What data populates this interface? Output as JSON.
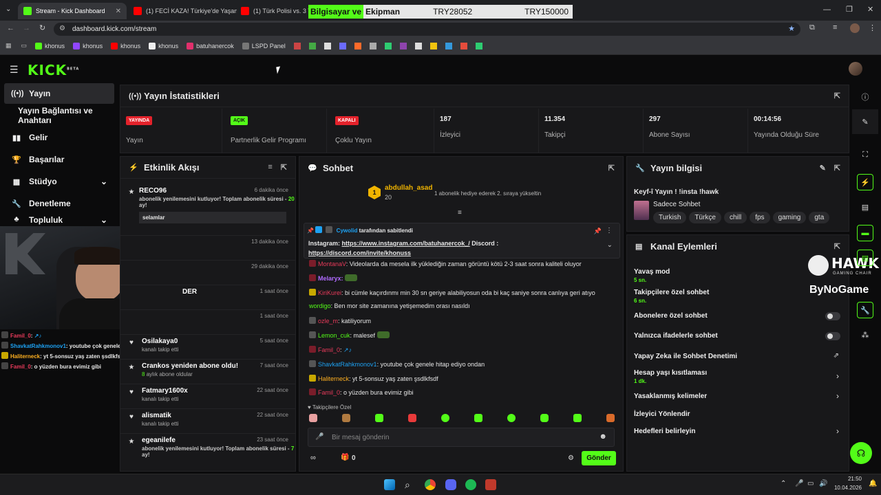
{
  "browser": {
    "tabs": [
      {
        "title": "Stream - Kick Dashboard",
        "active": true,
        "fav_color": "#53fc18"
      },
      {
        "title": "(1) FECİ KAZA! Türkiye'de Yaşan",
        "active": false,
        "fav_color": "#ff0000"
      },
      {
        "title": "(1) Türk Polisi vs. 3 Terö",
        "active": false,
        "fav_color": "#ff0000"
      }
    ],
    "overlay": {
      "text1": "Bilgisayar ve",
      "text2": "Ekipman",
      "price1": "TRY28052",
      "price2": "TRY150000"
    },
    "url": "dashboard.kick.com/stream",
    "bookmarks": [
      {
        "label": "khonus",
        "color": "#53fc18"
      },
      {
        "label": "khonus",
        "color": "#9146ff"
      },
      {
        "label": "khonus",
        "color": "#ff0000"
      },
      {
        "label": "khonus",
        "color": "#ffffff"
      },
      {
        "label": "batuhanercok",
        "color": "#e1306c"
      },
      {
        "label": "LSPD Panel",
        "color": "#777777"
      }
    ]
  },
  "sidebar": {
    "items": [
      {
        "label": "Yayın",
        "icon": "broadcast-icon",
        "active": true
      },
      {
        "label": "Yayın Bağlantısı ve Anahtarı",
        "icon": "",
        "active": false
      },
      {
        "label": "Gelir",
        "icon": "chart-icon",
        "active": false
      },
      {
        "label": "Başarılar",
        "icon": "trophy-icon",
        "active": false
      },
      {
        "label": "Stüdyo",
        "icon": "studio-icon",
        "active": false
      },
      {
        "label": "Denetleme",
        "icon": "wrench-icon",
        "active": false
      },
      {
        "label": "Topluluk",
        "icon": "community-icon",
        "active": false
      }
    ]
  },
  "stats": {
    "title": "Yayın İstatistikleri",
    "items": [
      {
        "pill": "YAYINDA",
        "pill_color": "#e4222b",
        "label": "Yayın"
      },
      {
        "pill": "AÇIK",
        "pill_color": "#53fc18",
        "label": "Partnerlik Gelir Programı"
      },
      {
        "pill": "KAPALI",
        "pill_color": "#e4222b",
        "label": "Çoklu Yayın"
      },
      {
        "value": "187",
        "label": "İzleyici"
      },
      {
        "value": "11.354",
        "label": "Takipçi"
      },
      {
        "value": "297",
        "label": "Abone Sayısı"
      },
      {
        "value": "00:14:56",
        "label": "Yayında Olduğu Süre"
      }
    ]
  },
  "activity": {
    "title": "Etkinlik Akışı",
    "events": [
      {
        "name": "RECO96",
        "time": "6 dakika önce",
        "desc": "abonelik yenilemesini kutluyor! Toplam abonelik süresi -",
        "months": "20",
        "msg": "selamlar"
      },
      {
        "name": "",
        "time": "13 dakika önce"
      },
      {
        "name": "",
        "time": "29 dakika önce"
      },
      {
        "name": "DER",
        "time": "1 saat önce"
      },
      {
        "name": "",
        "time": "1 saat önce"
      },
      {
        "name": "Osilakaya0",
        "time": "5 saat önce",
        "desc": "kanalı takip etti"
      },
      {
        "name": "Crankos yeniden abone oldu!",
        "time": "7 saat önce",
        "desc": "aylık abone oldular",
        "months": "8"
      },
      {
        "name": "Fatmary1600x",
        "time": "22 saat önce",
        "desc": "kanalı takip etti"
      },
      {
        "name": "alismatik",
        "time": "22 saat önce",
        "desc": "kanalı takip etti"
      },
      {
        "name": "egeanilefe",
        "time": "23 saat önce",
        "desc": "abonelik yenilemesini kutluyor! Toplam abonelik süresi -",
        "months": "7"
      }
    ]
  },
  "chat": {
    "title": "Sohbet",
    "top_user": "abdullah_asad",
    "top_count": "20",
    "top_msg": "1 abonelik hediye ederek 2. sıraya yükseltin",
    "pinned_by": "Cywolid",
    "pinned_suffix": "tarafından sabitlendi",
    "pinned_l1": "Instagram:",
    "pinned_link1": "https://www.instagram.com/batuhanercok_/",
    "pinned_mid": "Discord :",
    "pinned_link2": "https://discord.com/invite/khonuss",
    "messages": [
      {
        "user": "MontanaV",
        "color": "#e83a5a",
        "text": ": Videolarda da mesela ilk yüklediğin zaman görüntü kötü 2-3 saat sonra kaliteli oluyor"
      },
      {
        "user": "Melaryx:",
        "color": "#b06bff",
        "text": ""
      },
      {
        "user": "KiriKurei",
        "color": "#e83a5a",
        "text": ": bi cümle kaçırdınmı min 30 sn geriye alabiliyosun oda bi kaç saniye sonra canlıya geri atıyo"
      },
      {
        "user": "wordigo",
        "color": "#53fc18",
        "text": ": Ben mor site zamanına yetişemedim orası nasıldı"
      },
      {
        "user": "ozle_m",
        "color": "#e83a5a",
        "text": ": katiliyorum"
      },
      {
        "user": "Lemon_cuk",
        "color": "#53fc18",
        "text": ": malesef"
      },
      {
        "user": "Famil_0",
        "color": "#e83a5a",
        "text": ":"
      },
      {
        "user": "ShavkatRahkmonov1",
        "color": "#1da1f2",
        "text": ": youtube çok genele hitap ediyo ondan"
      },
      {
        "user": "Haliterneck",
        "color": "#ffb020",
        "text": ": yt 5-sonsuz yaş zaten şsdlkfsdf"
      },
      {
        "user": "Famil_0",
        "color": "#e83a5a",
        "text": ": o yüzden bura evimiz gibi"
      }
    ],
    "followers_only": "Takipçilere Özel",
    "placeholder": "Bir mesaj gönderin",
    "points": "0",
    "send_label": "Gönder"
  },
  "stream_info": {
    "title": "Yayın bilgisi",
    "stream_title": "Keyf-î Yayın ! !insta !hawk",
    "category": "Sadece Sohbet",
    "tags": [
      "Turkish",
      "Türkçe",
      "chill",
      "fps",
      "gaming",
      "gta"
    ]
  },
  "channel_actions": {
    "title": "Kanal Eylemleri",
    "rows": [
      {
        "label": "Yavaş mod",
        "sub": "5 sn.",
        "control": "none"
      },
      {
        "label": "Takipçilere özel sohbet",
        "sub": "6 sn.",
        "control": "none"
      },
      {
        "label": "Abonelere özel sohbet",
        "sub": "",
        "control": "toggle"
      },
      {
        "label": "Yalnızca ifadelerle sohbet",
        "sub": "",
        "control": "toggle"
      },
      {
        "label": "Yapay Zeka ile Sohbet Denetimi",
        "sub": "",
        "control": "external"
      },
      {
        "label": "Hesap yaşı kısıtlaması",
        "sub": "1 dk.",
        "control": "chevron"
      },
      {
        "label": "Yasaklanmış kelimeler",
        "sub": "",
        "control": "chevron"
      },
      {
        "label": "İzleyici Yönlendir",
        "sub": "",
        "control": "none"
      },
      {
        "label": "Hedefleri belirleyin",
        "sub": "",
        "control": "chevron"
      }
    ]
  },
  "sponsor": {
    "brand1": "HAWK",
    "brand1_sub": "GAMING CHAIR",
    "brand2": "ByNoGame"
  },
  "webcam_chat": [
    {
      "user": "Famil_0",
      "color": "#e83a5a",
      "text": ":"
    },
    {
      "user": "ShavkatRahkmonov1",
      "color": "#1da1f2",
      "text": ": youtube çok genele hitap ediyo ondan"
    },
    {
      "user": "Haliterneck",
      "color": "#ffb020",
      "text": ": yt 5-sonsuz yaş zaten şsdlkfsdf"
    },
    {
      "user": "Famil_0",
      "color": "#e83a5a",
      "text": ": o yüzden bura evimiz gibi"
    }
  ],
  "taskbar": {
    "time": "21:50",
    "date": "10.04.2026"
  },
  "colors": {
    "accent": "#53fc18",
    "panel": "#18181a",
    "bg": "#0b0b0c"
  }
}
